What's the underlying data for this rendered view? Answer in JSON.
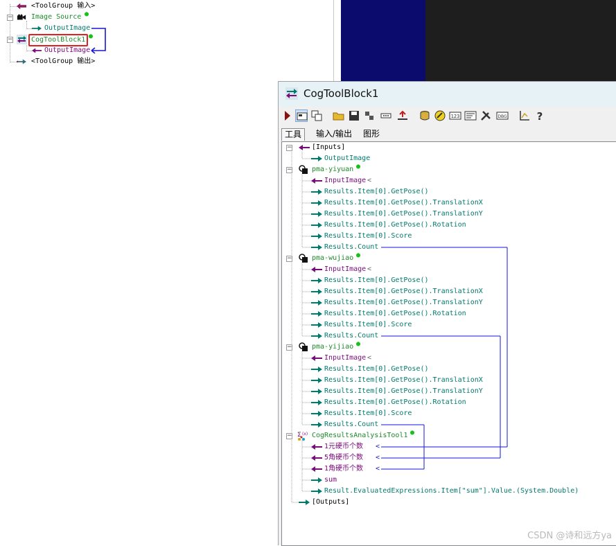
{
  "left_tree": {
    "toolgroup_input": "<ToolGroup 输入>",
    "image_source": "Image Source",
    "output_image": "OutputImage",
    "cog_tool_block": "CogToolBlock1",
    "cog_output_image": "OutputImage",
    "toolgroup_output": "<ToolGroup 输出>"
  },
  "window": {
    "title": "CogToolBlock1",
    "toolbar": [
      "run-icon",
      "show-display-icon",
      "show-image-icon",
      "open-icon",
      "save-icon",
      "reset-icon",
      "settings-icon",
      "output-icon",
      "database-icon",
      "link-icon",
      "number-icon",
      "terminal-icon",
      "tools-icon",
      "debug-icon",
      "chart-icon",
      "help-icon"
    ],
    "tabs": [
      {
        "label": "工具",
        "active": true
      },
      {
        "label": "输入/输出",
        "active": false
      },
      {
        "label": "图形",
        "active": false
      }
    ],
    "tree": {
      "inputs_label": "[Inputs]",
      "inputs_output_image": "OutputImage",
      "tool1": {
        "name": "pma-yiyuan",
        "input": "InputImage",
        "outputs": [
          "Results.Item[0].GetPose()",
          "Results.Item[0].GetPose().TranslationX",
          "Results.Item[0].GetPose().TranslationY",
          "Results.Item[0].GetPose().Rotation",
          "Results.Item[0].Score",
          "Results.Count"
        ]
      },
      "tool2": {
        "name": "pma-wujiao",
        "input": "InputImage",
        "outputs": [
          "Results.Item[0].GetPose()",
          "Results.Item[0].GetPose().TranslationX",
          "Results.Item[0].GetPose().TranslationY",
          "Results.Item[0].GetPose().Rotation",
          "Results.Item[0].Score",
          "Results.Count"
        ]
      },
      "tool3": {
        "name": "pma-yijiao",
        "input": "InputImage",
        "outputs": [
          "Results.Item[0].GetPose()",
          "Results.Item[0].GetPose().TranslationX",
          "Results.Item[0].GetPose().TranslationY",
          "Results.Item[0].GetPose().Rotation",
          "Results.Item[0].Score",
          "Results.Count"
        ]
      },
      "results_tool": {
        "name": "CogResultsAnalysisTool1",
        "inputs": [
          "1元硬币个数",
          "5角硬币个数",
          "1角硬币个数"
        ],
        "outputs": [
          "sum",
          "Result.EvaluatedExpressions.Item[\"sum\"].Value.(System.Double)"
        ]
      },
      "outputs_label": "[Outputs]"
    }
  },
  "watermark": "CSDN @诗和远方ya",
  "colors": {
    "teal": "#007a6e",
    "purple": "#7a0a7a",
    "link_blue": "#1515d8",
    "highlight_red": "#e02020",
    "navy": "#0b0b6e"
  }
}
